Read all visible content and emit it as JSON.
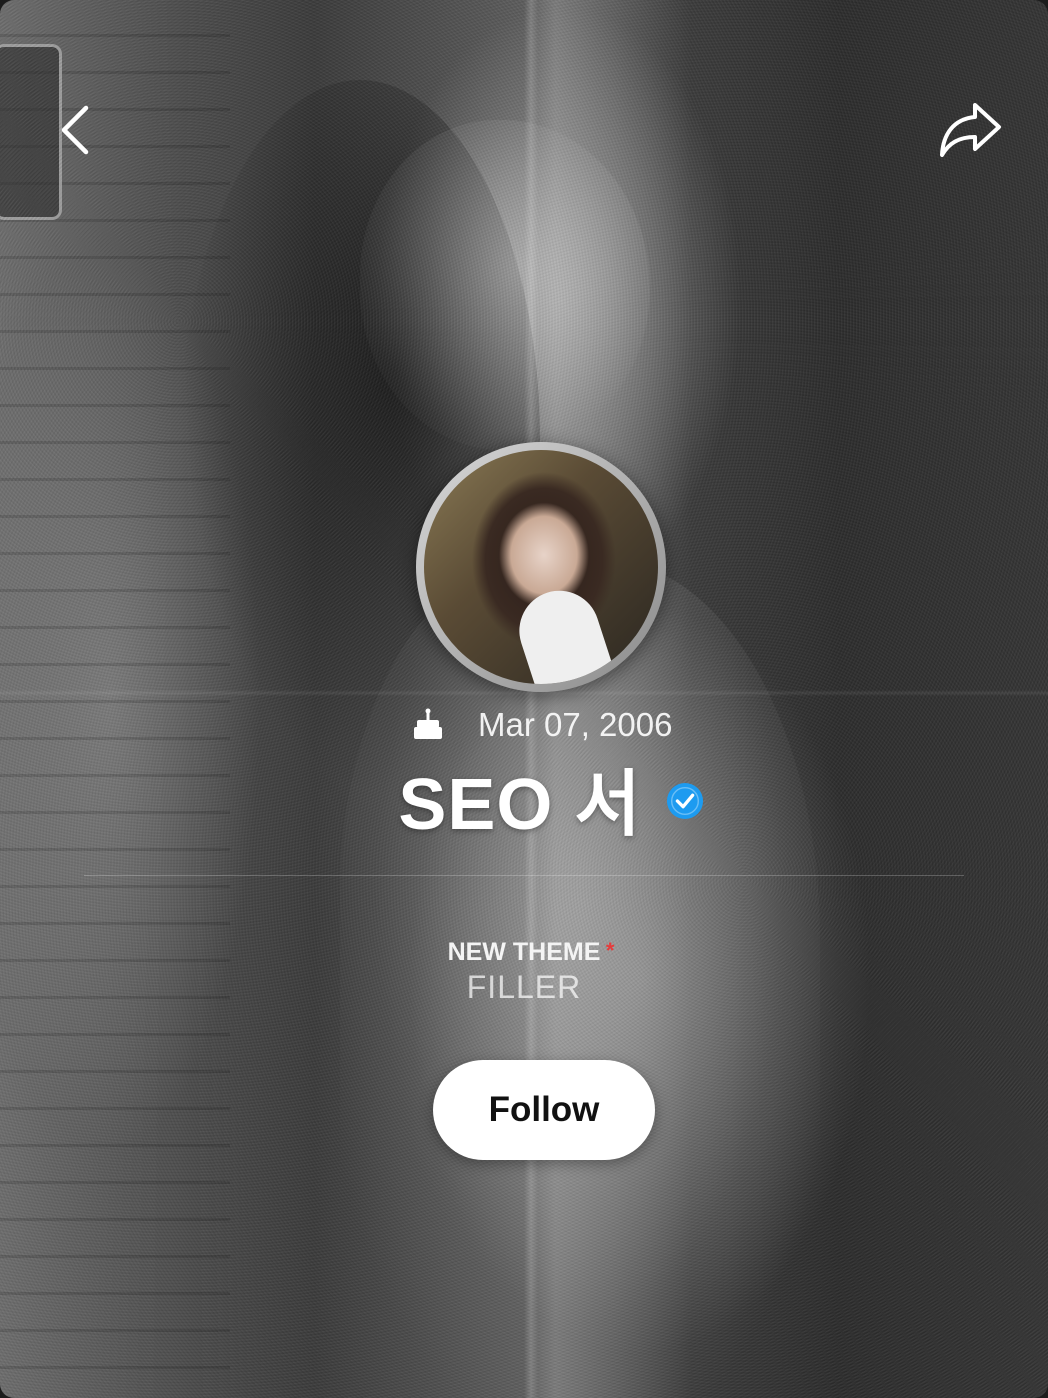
{
  "header": {
    "back_icon": "chevron-left-icon",
    "share_icon": "share-arrow-icon"
  },
  "profile": {
    "birthday_icon": "cake-icon",
    "birthday": "Mar 07, 2006",
    "name": "SEO 서",
    "verified_icon": "verified-badge-icon",
    "verified_color": "#1d9bf0"
  },
  "theme": {
    "title": "NEW THEME",
    "marker": "*",
    "marker_color": "#e63b3b",
    "subtitle": "FILLER"
  },
  "actions": {
    "follow_label": "Follow"
  }
}
